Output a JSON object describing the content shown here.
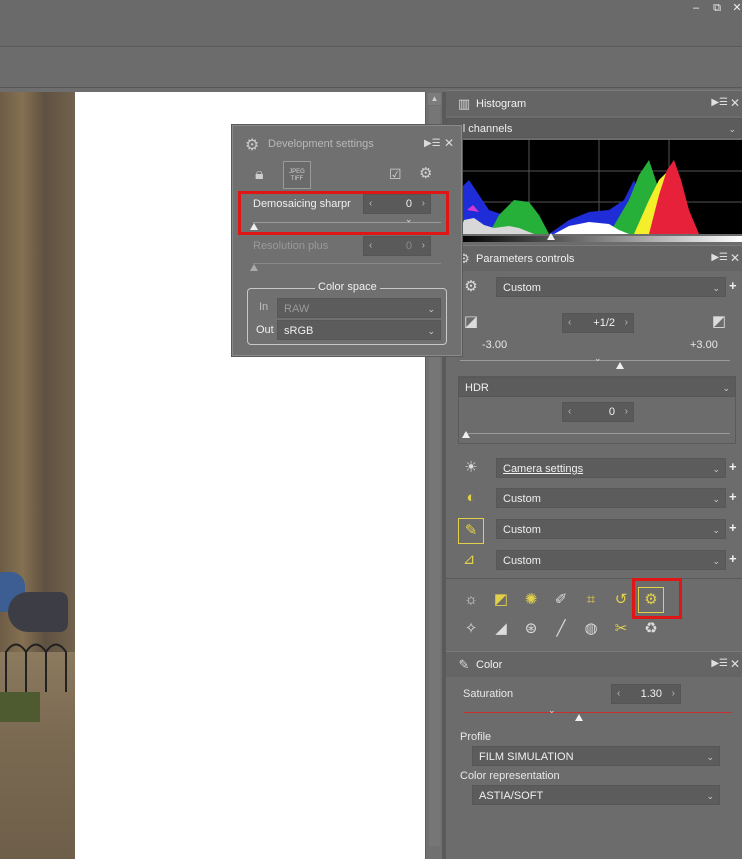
{
  "window": {
    "minimize": "–",
    "restore": "⧉",
    "close": "✕"
  },
  "histogram": {
    "title": "Histogram",
    "icon": "histogram-icon",
    "channel_select": "All channels"
  },
  "parameters": {
    "title": "Parameters controls",
    "preset": "Custom",
    "exposure": {
      "value": "+1/2",
      "min": "-3.00",
      "max": "+3.00"
    },
    "hdr": {
      "label": "HDR",
      "value": "0"
    },
    "white_balance": "Camera settings",
    "contrast": "Custom",
    "color_tool": "Custom",
    "sharpen_tool": "Custom"
  },
  "color": {
    "title": "Color",
    "saturation_label": "Saturation",
    "saturation_value": "1.30",
    "profile_label": "Profile",
    "profile_value": "FILM SIMULATION",
    "representation_label": "Color representation",
    "representation_value": "ASTIA/SOFT"
  },
  "dev": {
    "title": "Development settings",
    "jpeg_tiff": "JPEG\nTIFF",
    "demosaicing_label": "Demosaicing sharpr",
    "demosaicing_value": "0",
    "resolution_label": "Resolution plus",
    "resolution_value": "0",
    "color_space_legend": "Color space",
    "in_label": "In",
    "in_value": "RAW",
    "out_label": "Out",
    "out_value": "sRGB"
  },
  "colors": {
    "accent_yellow": "#e3d04a",
    "highlight_red": "#e01515",
    "panel_bg": "#6c6c6c"
  }
}
